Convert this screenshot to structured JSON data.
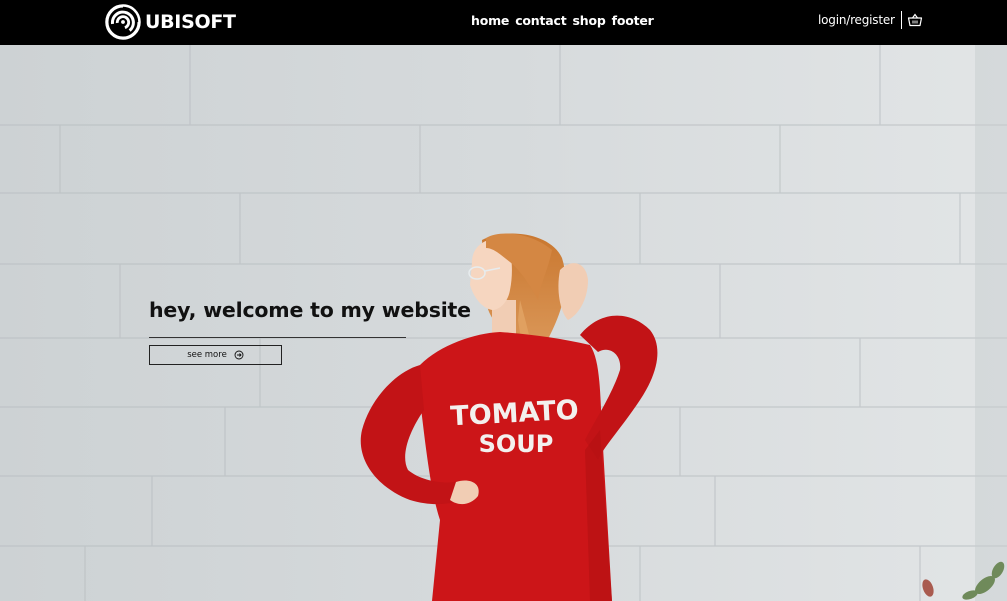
{
  "brand": {
    "name": "UBISOFT"
  },
  "nav": {
    "links": [
      "home",
      "contact",
      "shop",
      "footer"
    ],
    "login_label": "login/register",
    "cart_icon": "basket-icon"
  },
  "hero": {
    "headline": "hey, welcome to my website",
    "button_label": "see more",
    "button_icon": "arrow-circle-right-icon",
    "shirt_text_line1": "TOMATO",
    "shirt_text_line2": "SOUP"
  },
  "colors": {
    "navbar_bg": "#000000",
    "wall": "#d6dadb",
    "sweater": "#cc1518",
    "hair": "#d9904f"
  }
}
